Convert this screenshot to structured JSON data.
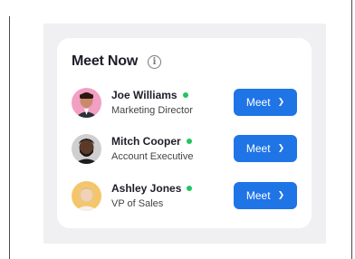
{
  "widget": {
    "title": "Meet Now",
    "info_icon": "info-icon"
  },
  "people": [
    {
      "name": "Joe Williams",
      "role": "Marketing Director",
      "status": "online",
      "button_label": "Meet",
      "avatar_bg": "#f29fc3"
    },
    {
      "name": "Mitch Cooper",
      "role": "Account Executive",
      "status": "online",
      "button_label": "Meet",
      "avatar_bg": "#cfcfcf"
    },
    {
      "name": "Ashley Jones",
      "role": "VP of Sales",
      "status": "online",
      "button_label": "Meet",
      "avatar_bg": "#f6c56a"
    }
  ],
  "colors": {
    "accent": "#1f74e6",
    "online": "#22c55e",
    "panel_bg": "#f0f0f2",
    "text": "#1e1e2a"
  }
}
